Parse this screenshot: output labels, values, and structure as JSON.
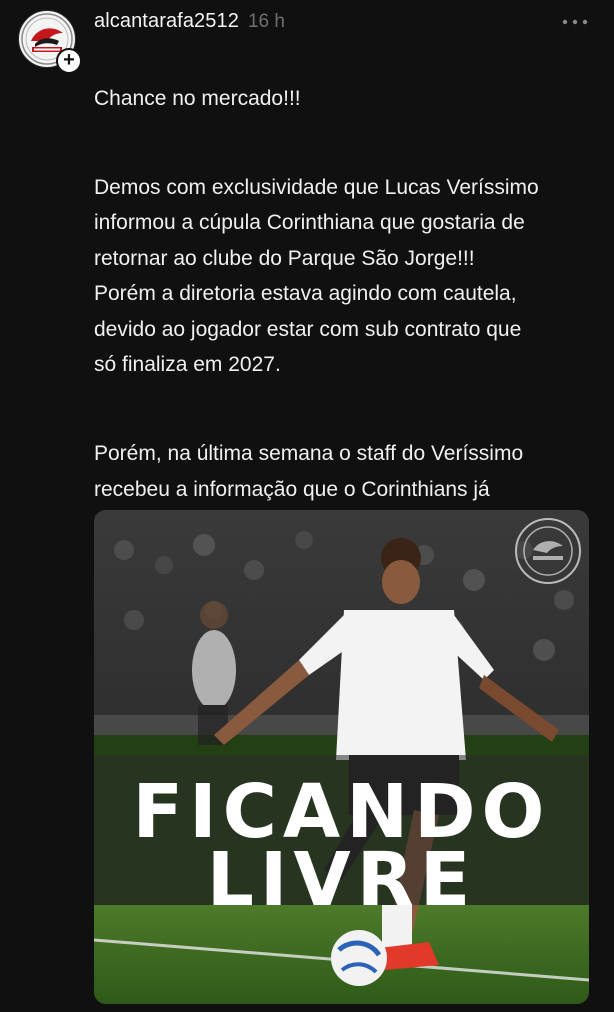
{
  "post": {
    "username": "alcantarafa2512",
    "time": "16 h",
    "title": "Chance no mercado!!!",
    "paragraph_1": "Demos com exclusividade que Lucas Veríssimo\ninformou a cúpula Corinthiana que gostaria de\nretornar ao clube do Parque São Jorge!!!\nPorém a diretoria estava agindo com cautela,\ndevido ao  jogador estar com sub contrato que\nsó finaliza em 2027.",
    "paragraph_2": "Porém, na última semana o staff do Veríssimo\nrecebeu a informação que o Corinthians já\niniciou a busca por reforços, e precisa de uma\ndefinição do jogador.\nCom isso o defensor já intensificou sua saída do\nclube Al Duhail.",
    "image": {
      "overlay_line_1": "FICANDO",
      "overlay_line_2": "LIVRE"
    }
  },
  "icons": {
    "more": "more-horizontal-icon",
    "follow": "plus-icon"
  },
  "colors": {
    "background": "#101010",
    "text": "#f0f0f0",
    "muted": "#6f6f6f"
  }
}
